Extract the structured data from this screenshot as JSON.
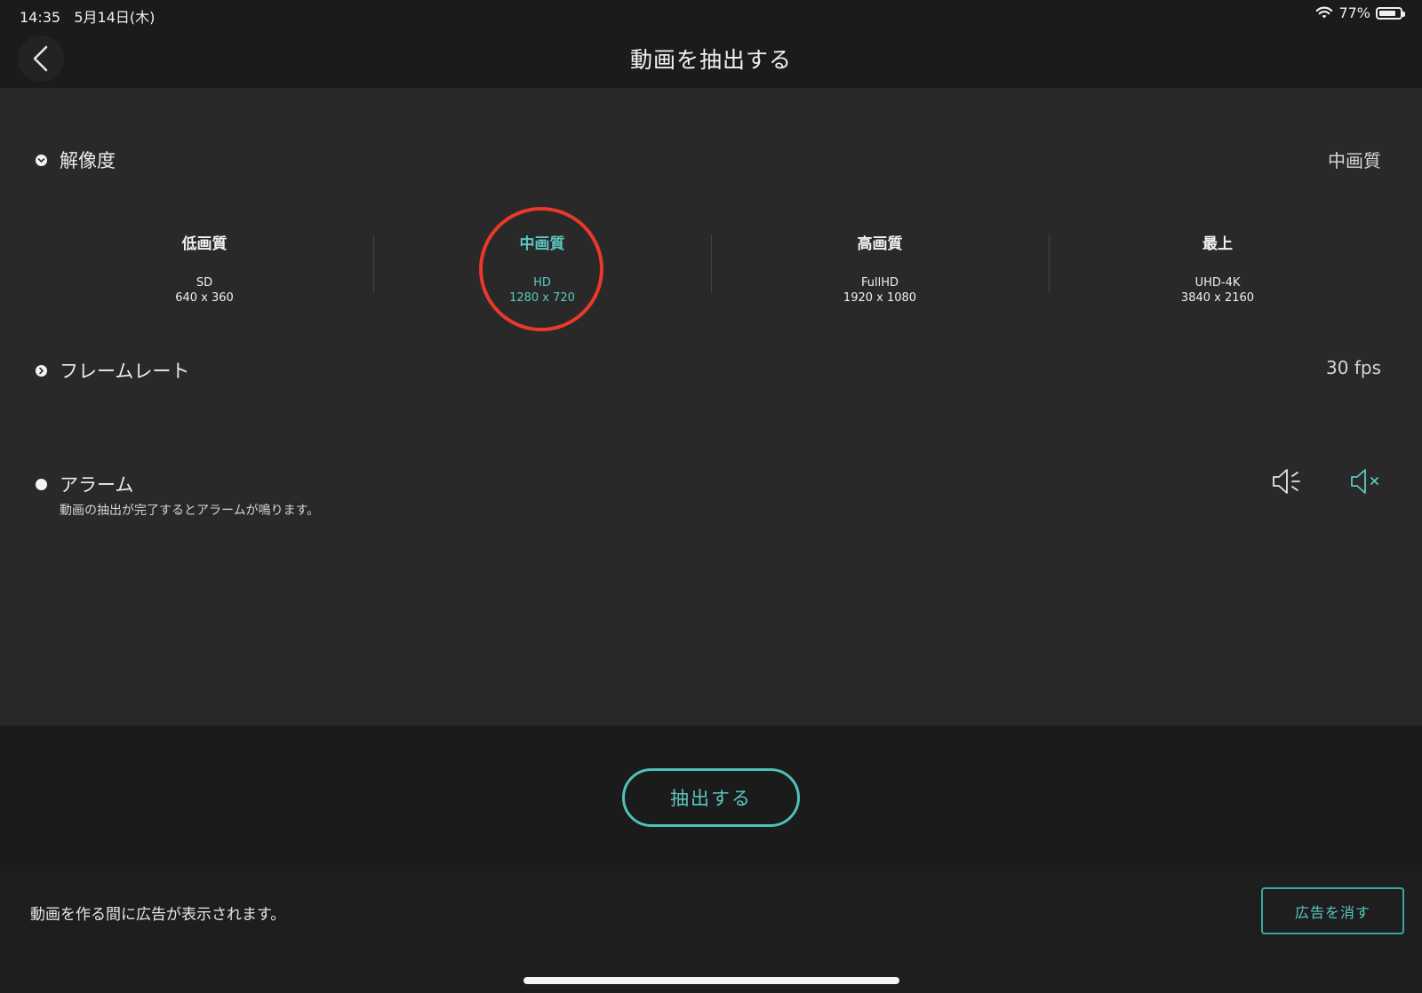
{
  "status_bar": {
    "time": "14:35",
    "date": "5月14日(木)",
    "battery_percent": "77%",
    "wifi_icon": "wifi-icon",
    "battery_level": 0.77
  },
  "header": {
    "title": "動画を抽出する",
    "back_icon": "chevron-left-icon"
  },
  "resolution": {
    "label": "解像度",
    "value": "中画質",
    "options": [
      {
        "name": "低画質",
        "standard": "SD",
        "dimensions": "640 x 360",
        "selected": false
      },
      {
        "name": "中画質",
        "standard": "HD",
        "dimensions": "1280 x 720",
        "selected": true
      },
      {
        "name": "高画質",
        "standard": "FullHD",
        "dimensions": "1920 x 1080",
        "selected": false
      },
      {
        "name": "最上",
        "standard": "UHD-4K",
        "dimensions": "3840 x 2160",
        "selected": false
      }
    ]
  },
  "frame_rate": {
    "label": "フレームレート",
    "value": "30 fps"
  },
  "alarm": {
    "label": "アラーム",
    "description": "動画の抽出が完了するとアラームが鳴ります。",
    "sound_on_icon": "speaker-on-icon",
    "sound_off_icon": "speaker-muted-icon",
    "selected": "off"
  },
  "actions": {
    "extract_label": "抽出する"
  },
  "ad_bar": {
    "message": "動画を作る間に広告が表示されます。",
    "remove_ads_label": "広告を消す"
  },
  "colors": {
    "accent": "#5cc7c0",
    "highlight": "#e8392b",
    "background": "#1b1b1b",
    "panel": "#292929"
  }
}
